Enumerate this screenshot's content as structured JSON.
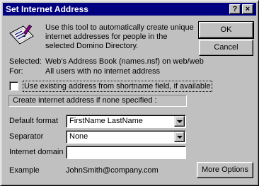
{
  "window": {
    "title": "Set Internet Address",
    "help_glyph": "?",
    "close_glyph": "×"
  },
  "buttons": {
    "ok": "OK",
    "cancel": "Cancel",
    "more_options": "More Options"
  },
  "intro_text": "Use this tool to automatically create unique internet addresses for people in the selected Domino Directory.",
  "selected": {
    "label": "Selected:",
    "value": "Web's Address Book (names.nsf) on web/web"
  },
  "for": {
    "label": "For:",
    "value": "All users with no internet address"
  },
  "use_shortname": {
    "label": "Use existing address from shortname field, if available",
    "checked": false
  },
  "group_header": "Create internet address if none specified :",
  "default_format": {
    "label": "Default format",
    "value": "FirstName LastName"
  },
  "separator": {
    "label": "Separator",
    "value": "None"
  },
  "internet_domain": {
    "label": "Internet domain",
    "value": ""
  },
  "example": {
    "label": "Example",
    "value": "JohnSmith@company.com"
  },
  "icons": {
    "tool": "address-card-pen-icon"
  }
}
